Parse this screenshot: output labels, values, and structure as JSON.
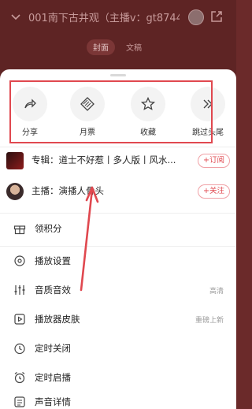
{
  "header": {
    "title": "001南下古井观（主播v：gt8744",
    "segments": [
      "封面",
      "文稿"
    ]
  },
  "actions": [
    {
      "label": "分享",
      "icon": "share-icon"
    },
    {
      "label": "月票",
      "icon": "ticket-icon"
    },
    {
      "label": "收藏",
      "icon": "star-icon"
    },
    {
      "label": "跳过头尾",
      "icon": "skip-icon"
    }
  ],
  "album": {
    "text": "专辑：道士不好惹丨多人版丨风水...",
    "button": "+订阅"
  },
  "anchor": {
    "text": "主播：演播人骨头",
    "button": "+关注"
  },
  "points": {
    "label": "领积分"
  },
  "menu": [
    {
      "label": "播放设置",
      "value": "",
      "icon": "settings-icon"
    },
    {
      "label": "音质音效",
      "value": "高清",
      "icon": "equalizer-icon"
    },
    {
      "label": "播放器皮肤",
      "value": "重磅上新",
      "icon": "skin-icon"
    },
    {
      "label": "定时关闭",
      "value": "",
      "icon": "timer-icon"
    },
    {
      "label": "定时启播",
      "value": "",
      "icon": "alarm-icon"
    },
    {
      "label": "声音详情",
      "value": "",
      "icon": "info-icon"
    }
  ],
  "colors": {
    "accent": "#e0484f",
    "annotation": "#e0484f"
  }
}
